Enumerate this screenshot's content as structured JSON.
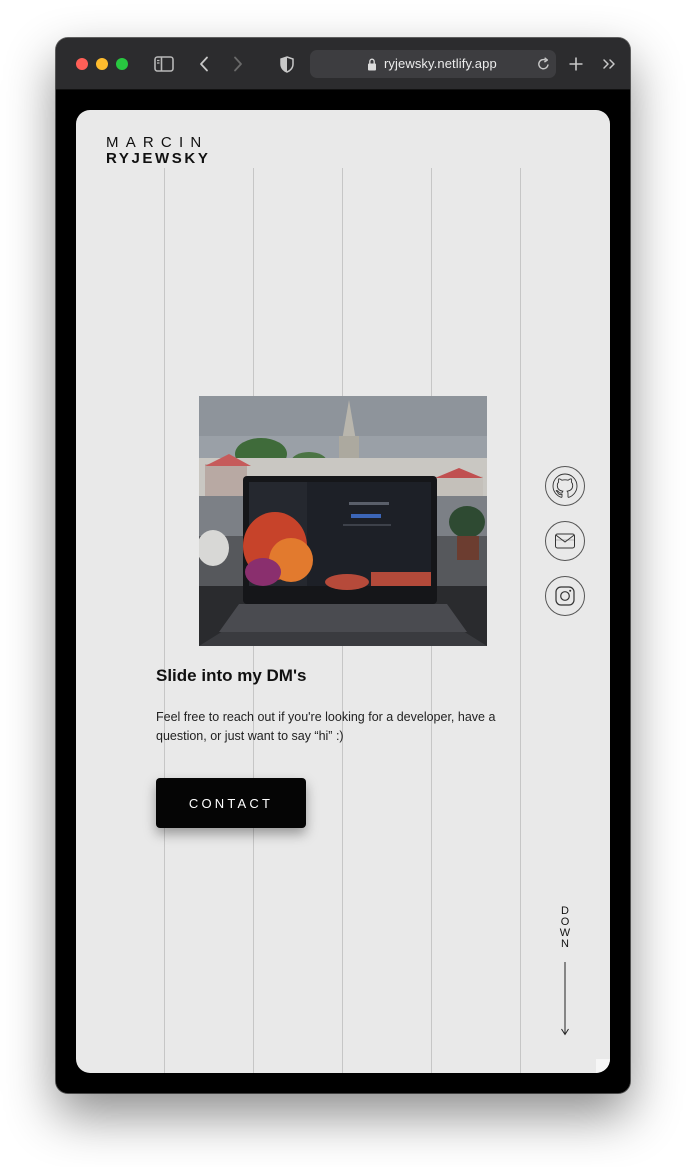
{
  "browser": {
    "url": "ryjewsky.netlify.app",
    "colors": {
      "close": "#ff5f57",
      "minimize": "#febc2e",
      "zoom": "#28c840"
    },
    "icons": [
      "sidebar-icon",
      "back-icon",
      "forward-icon",
      "shield-icon",
      "lock-icon",
      "reload-icon",
      "new-tab-icon",
      "more-tabs-icon"
    ]
  },
  "site": {
    "logo": {
      "first": "MARCIN",
      "last": "RYJEWSKY"
    },
    "hero": {
      "headline": "Slide into my DM's",
      "body": "Feel free to reach out if you're looking for a developer, have a question, or just want to say “hi” :)",
      "button_label": "CONTACT",
      "image_desc": "laptop-on-desk-photo"
    },
    "social": [
      "github-icon",
      "mail-icon",
      "instagram-icon"
    ],
    "scroll_hint": [
      "D",
      "O",
      "W",
      "N"
    ]
  }
}
